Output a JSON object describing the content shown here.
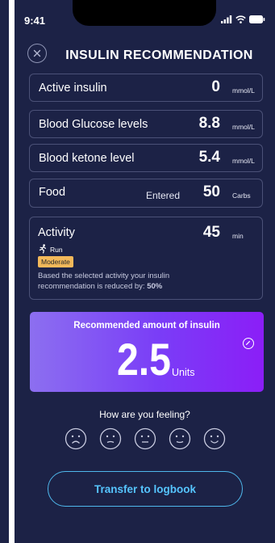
{
  "status_bar": {
    "time": "9:41"
  },
  "header": {
    "title": "INSULIN RECOMMENDATION"
  },
  "rows": {
    "active_insulin": {
      "label": "Active insulin",
      "value": "0",
      "unit": "mmol/L"
    },
    "blood_glucose": {
      "label": "Blood Glucose levels",
      "value": "8.8",
      "unit": "mmol/L"
    },
    "blood_ketone": {
      "label": "Blood ketone level",
      "value": "5.4",
      "unit": "mmol/L"
    },
    "food": {
      "label": "Food",
      "status": "Entered",
      "value": "50",
      "unit": "Carbs"
    }
  },
  "activity": {
    "label": "Activity",
    "value": "45",
    "unit": "min",
    "type": "Run",
    "intensity": "Moderate",
    "note": "Based the selected activity your insulin recommendation is reduced by:",
    "reduction": "50%"
  },
  "recommendation": {
    "title": "Recommended amount of insulin",
    "value": "2.5",
    "unit": "Units"
  },
  "feeling": {
    "prompt": "How are you feeling?",
    "options": [
      "very-sad",
      "sad",
      "neutral",
      "content",
      "happy"
    ]
  },
  "transfer_button": {
    "label": "Transfer to logbook"
  },
  "colors": {
    "background": "#1c2246",
    "card_border": "#4b5177",
    "badge": "#f2b85a",
    "accent": "#56c5ff",
    "gradient_start": "#8c6ff0",
    "gradient_end": "#8b1ef7"
  }
}
